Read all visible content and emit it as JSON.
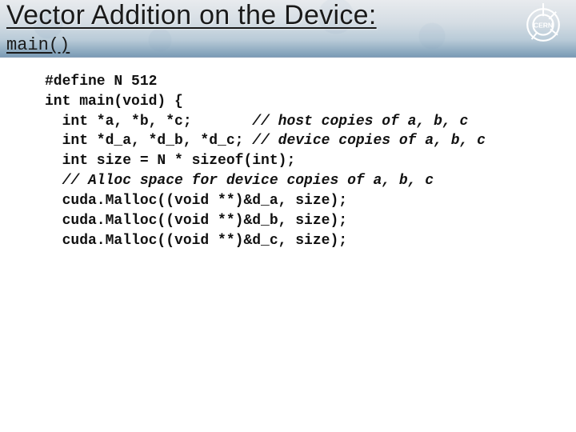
{
  "header": {
    "title": "Vector Addition on the Device:",
    "subtitle": "main()",
    "logo_label": "CERN"
  },
  "code": {
    "lines": [
      {
        "text": "#define N 512",
        "indent": 0
      },
      {
        "text": "int main(void) {",
        "indent": 0
      },
      {
        "text": "int *a, *b, *c;       ",
        "indent": 1,
        "comment": "// host copies of a, b, c"
      },
      {
        "text": "int *d_a, *d_b, *d_c; ",
        "indent": 1,
        "comment": "// device copies of a, b, c"
      },
      {
        "text": "int size = N * sizeof(int);",
        "indent": 1
      },
      {
        "text": "",
        "indent": 1,
        "comment": "// Alloc space for device copies of a, b, c"
      },
      {
        "text": "cuda.Malloc((void **)&d_a, size);",
        "indent": 1
      },
      {
        "text": "cuda.Malloc((void **)&d_b, size);",
        "indent": 1
      },
      {
        "text": "cuda.Malloc((void **)&d_c, size);",
        "indent": 1
      }
    ]
  }
}
